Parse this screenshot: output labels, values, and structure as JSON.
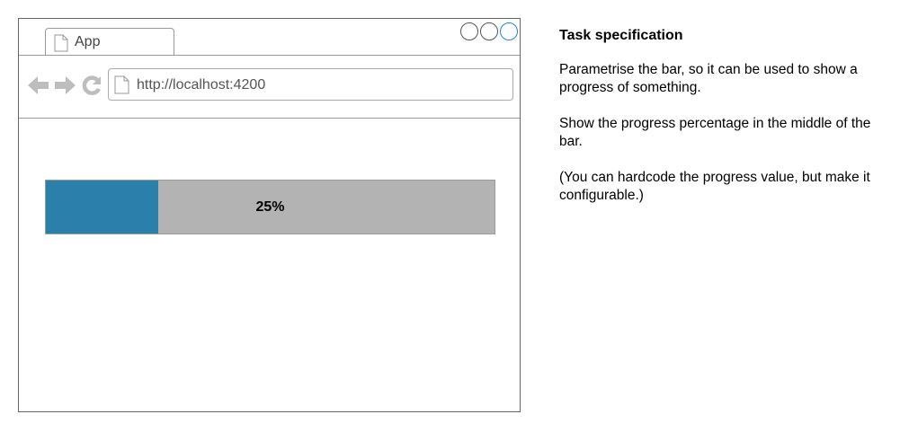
{
  "browser": {
    "tab": {
      "label": "App",
      "icon": "page-icon"
    },
    "controls": [
      "circle-button",
      "circle-button",
      "circle-button"
    ],
    "nav": {
      "back_icon": "back-arrow-icon",
      "forward_icon": "forward-arrow-icon",
      "reload_icon": "reload-icon"
    },
    "url": {
      "value": "http://localhost:4200",
      "icon": "page-icon"
    },
    "colors": {
      "progress_fill": "#2a7fab",
      "progress_track": "#b3b3b3",
      "nav_icons": "#bdbdbd"
    }
  },
  "progress": {
    "value": 0.25,
    "label": "25%"
  },
  "spec": {
    "title": "Task specification",
    "paragraphs": [
      "Parametrise the bar, so it can be used to show a progress of something.",
      "Show the progress percentage in the middle of the bar.",
      "(You can hardcode the progress value, but make it configurable.)"
    ]
  }
}
